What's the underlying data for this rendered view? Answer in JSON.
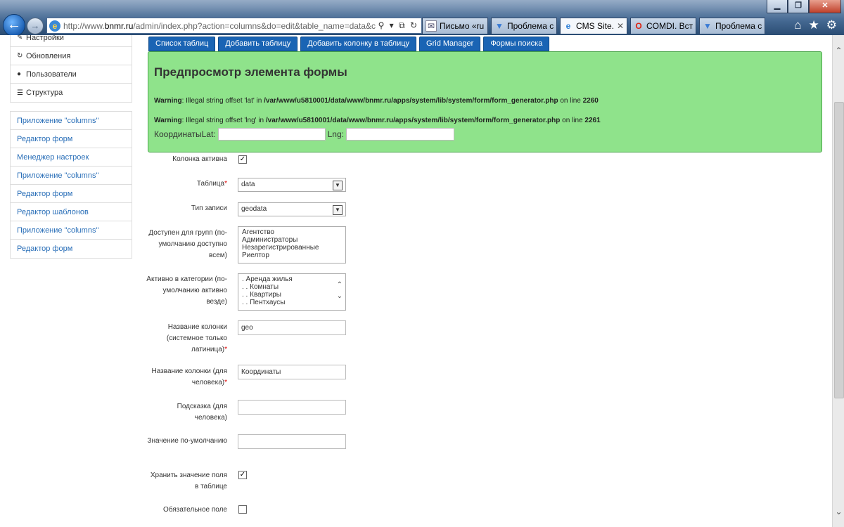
{
  "browser": {
    "address_prefix": "http://www.",
    "address_domain": "bnmr.ru",
    "address_rest": "/admin/index.php?action=columns&do=edit&table_name=data&c",
    "address_tools": "⚲ ▾ ⧉ ↻",
    "tabs": [
      {
        "label": "Письмо «ru...",
        "icon": "mail-icon",
        "active": false
      },
      {
        "label": "Проблема с...",
        "icon": "stackoverflow-icon",
        "active": false
      },
      {
        "label": "CMS Site...",
        "icon": "ie-page-icon",
        "active": true,
        "close": "✕"
      },
      {
        "label": "COMDI. Вст...",
        "icon": "opera-icon",
        "active": false
      },
      {
        "label": "Проблема с...",
        "icon": "stackoverflow-icon",
        "active": false
      }
    ],
    "window_buttons": {
      "minimize": "▁",
      "restore": "❐",
      "close": "✕"
    }
  },
  "sidebar": {
    "group1": [
      {
        "label": "Настройки",
        "icon": "wrench-icon"
      },
      {
        "label": "Обновления",
        "icon": "refresh-icon"
      },
      {
        "label": "Пользователи",
        "icon": "user-icon"
      },
      {
        "label": "Структура",
        "icon": "list-icon"
      }
    ],
    "group2": [
      "Приложение \"columns\"",
      "Редактор форм",
      "Менеджер настроек",
      "Приложение \"columns\"",
      "Редактор форм",
      "Редактор шаблонов",
      "Приложение \"columns\"",
      "Редактор форм"
    ]
  },
  "top_buttons": [
    "Список таблиц",
    "Добавить таблицу",
    "Добавить колонку в таблицу",
    "Grid Manager",
    "Формы поиска"
  ],
  "preview": {
    "title": "Предпросмотр элемента формы",
    "warning_label": "Warning",
    "warning1_text": ": Illegal string offset 'lat' in ",
    "warning1_path": "/var/www/u5810001/data/www/bnmr.ru/apps/system/lib/system/form/form_generator.php",
    "warning1_on": " on line ",
    "warning1_line": "2260",
    "warning2_text": ": Illegal string offset 'lng' in ",
    "warning2_path": "/var/www/u5810001/data/www/bnmr.ru/apps/system/lib/system/form/form_generator.php",
    "warning2_on": " on line ",
    "warning2_line": "2261",
    "coords_label": "Координаты",
    "lat_label": "Lat:",
    "lng_label": "Lng:"
  },
  "form": {
    "active_label": "Колонка активна",
    "active_checked": true,
    "table_label": "Таблица",
    "table_value": "data",
    "type_label": "Тип записи",
    "type_value": "geodata",
    "groups_label": "Доступен для групп (по-умолчанию доступно всем)",
    "groups_options": [
      "Агентство",
      "Администраторы",
      "Незарегистрированные",
      "Риелтор"
    ],
    "categories_label": "Активно в категории (по-умолчанию активно везде)",
    "categories_options": [
      ". Аренда жилья",
      ". . Комнаты",
      ". . Квартиры",
      ". . Пентхаусы"
    ],
    "colname_label": "Название колонки (системное только латиница)",
    "colname_value": "geo",
    "human_label": "Название колонки (для человека)",
    "human_value": "Координаты",
    "hint_label": "Подсказка (для человека)",
    "hint_value": "",
    "default_label": "Значение по-умолчанию",
    "default_value": "",
    "store_label": "Хранить значение поля в таблице",
    "store_checked": true,
    "required_label": "Обязательное поле",
    "required_checked": false,
    "required_mark": "*"
  }
}
